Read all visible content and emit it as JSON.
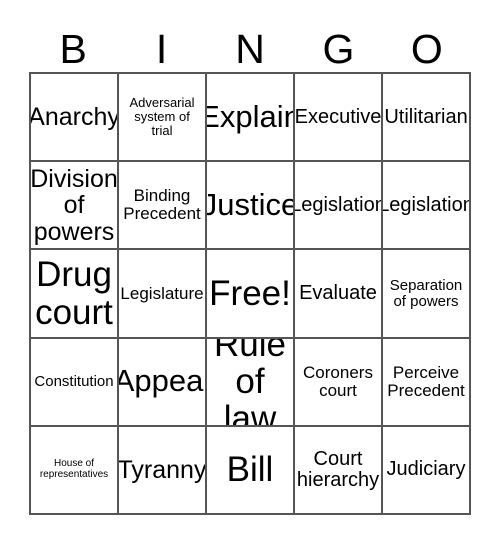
{
  "card": {
    "title": "BINGO",
    "headers": [
      "B",
      "I",
      "N",
      "G",
      "O"
    ],
    "free_space_label": "Free!",
    "colors": {
      "background": "#ffffff",
      "border": "#555555",
      "text": "#000000"
    },
    "rows": [
      [
        {
          "label": "Anarchy",
          "size": "lg",
          "free": false
        },
        {
          "label": "Adversarial system of trial",
          "size": "xxs",
          "free": false
        },
        {
          "label": "Explain",
          "size": "xl",
          "free": false
        },
        {
          "label": "Executive",
          "size": "md",
          "free": false
        },
        {
          "label": "Utilitarian",
          "size": "md",
          "free": false
        }
      ],
      [
        {
          "label": "Division of powers",
          "size": "lg",
          "free": false
        },
        {
          "label": "Binding Precedent",
          "size": "sm",
          "free": false
        },
        {
          "label": "Justice",
          "size": "xl",
          "free": false
        },
        {
          "label": "Legislation",
          "size": "md",
          "free": false
        },
        {
          "label": "Legislation",
          "size": "md",
          "free": false
        }
      ],
      [
        {
          "label": "Drug court",
          "size": "xxl",
          "free": false
        },
        {
          "label": "Legislature",
          "size": "sm",
          "free": false
        },
        {
          "label": "Free!",
          "size": "xxl",
          "free": true
        },
        {
          "label": "Evaluate",
          "size": "md",
          "free": false
        },
        {
          "label": "Separation of powers",
          "size": "xs",
          "free": false
        }
      ],
      [
        {
          "label": "Constitution",
          "size": "xs",
          "free": false
        },
        {
          "label": "Appeal",
          "size": "xl",
          "free": false
        },
        {
          "label": "Rule of law",
          "size": "xxl",
          "free": false
        },
        {
          "label": "Coroners court",
          "size": "sm",
          "free": false
        },
        {
          "label": "Perceive Precedent",
          "size": "sm",
          "free": false
        }
      ],
      [
        {
          "label": "House of representatives",
          "size": "tiny",
          "free": false
        },
        {
          "label": "Tyranny",
          "size": "lg",
          "free": false
        },
        {
          "label": "Bill",
          "size": "xxl",
          "free": false
        },
        {
          "label": "Court hierarchy",
          "size": "md",
          "free": false
        },
        {
          "label": "Judiciary",
          "size": "md",
          "free": false
        }
      ]
    ]
  }
}
